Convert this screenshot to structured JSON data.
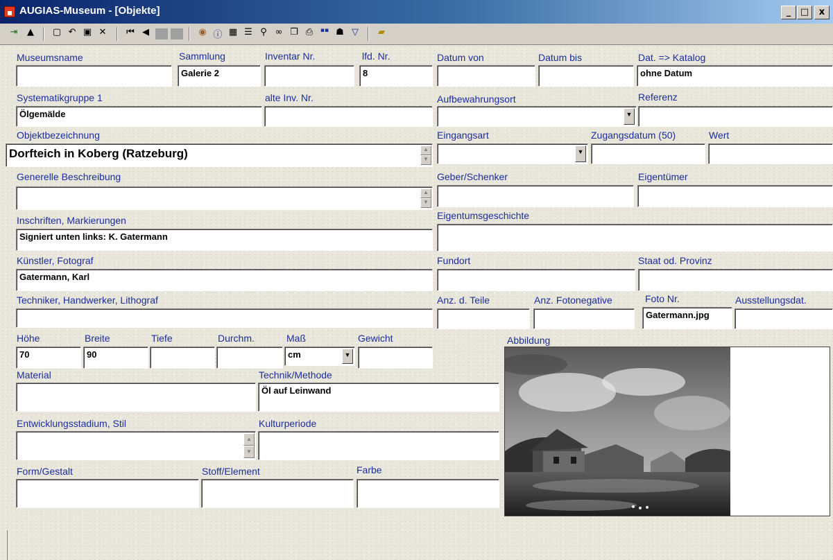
{
  "window": {
    "title": "AUGIAS-Museum - [Objekte]",
    "controls": [
      "_",
      "□",
      "x"
    ]
  },
  "toolbar": {
    "icons": [
      "new-record-icon",
      "up-arrow-icon",
      "new-document-icon",
      "undo-icon",
      "save-icon",
      "delete-icon",
      "first-record-icon",
      "previous-record-icon",
      "next-record-icon",
      "last-record-icon",
      "globe-icon",
      "info-icon",
      "image-icon",
      "list-icon",
      "search-icon",
      "binoculars-icon",
      "copy-icon",
      "print-icon",
      "text-icon",
      "person-icon",
      "filter-icon",
      "folder-icon"
    ]
  },
  "form": {
    "museumsname": {
      "label": "Museumsname",
      "value": ""
    },
    "sammlung": {
      "label": "Sammlung",
      "value": "Galerie 2"
    },
    "inventar_nr": {
      "label": "Inventar Nr.",
      "value": ""
    },
    "lfd_nr": {
      "label": "lfd. Nr.",
      "value": "8"
    },
    "datum_von": {
      "label": "Datum von",
      "value": ""
    },
    "datum_bis": {
      "label": "Datum bis",
      "value": ""
    },
    "dat_katalog": {
      "label": "Dat. => Katalog",
      "value": "ohne Datum"
    },
    "systematikgruppe": {
      "label": "Systematikgruppe 1",
      "value": "Ölgemälde"
    },
    "alte_inv_nr": {
      "label": "alte Inv. Nr.",
      "value": ""
    },
    "aufbewahrungsort": {
      "label": "Aufbewahrungsort",
      "value": ""
    },
    "referenz": {
      "label": "Referenz",
      "value": ""
    },
    "objektbezeichnung": {
      "label": "Objektbezeichnung",
      "value": "Dorfteich in Koberg (Ratzeburg)"
    },
    "eingangsart": {
      "label": "Eingangsart",
      "value": ""
    },
    "zugangsdatum": {
      "label": "Zugangsdatum (50)",
      "value": ""
    },
    "wert": {
      "label": "Wert",
      "value": ""
    },
    "generelle_beschreibung": {
      "label": "Generelle Beschreibung",
      "value": ""
    },
    "geber_schenker": {
      "label": "Geber/Schenker",
      "value": ""
    },
    "eigentuemer": {
      "label": "Eigentümer",
      "value": ""
    },
    "eigentumsgeschichte": {
      "label": "Eigentumsgeschichte",
      "value": ""
    },
    "inschriften": {
      "label": "Inschriften, Markierungen",
      "value": "Signiert unten links: K. Gatermann"
    },
    "kuenstler": {
      "label": "Künstler, Fotograf",
      "value": "Gatermann, Karl"
    },
    "fundort": {
      "label": "Fundort",
      "value": ""
    },
    "staat": {
      "label": "Staat od. Provinz",
      "value": ""
    },
    "techniker": {
      "label": "Techniker, Handwerker, Lithograf",
      "value": ""
    },
    "anz_teile": {
      "label": "Anz. d. Teile",
      "value": ""
    },
    "anz_fotonegative": {
      "label": "Anz. Fotonegative",
      "value": ""
    },
    "foto_nr": {
      "label": "Foto Nr.",
      "value": "Gatermann.jpg"
    },
    "ausstellungsdat": {
      "label": "Ausstellungsdat.",
      "value": ""
    },
    "hoehe": {
      "label": "Höhe",
      "value": "70"
    },
    "breite": {
      "label": "Breite",
      "value": "90"
    },
    "tiefe": {
      "label": "Tiefe",
      "value": ""
    },
    "durchm": {
      "label": "Durchm.",
      "value": ""
    },
    "mass": {
      "label": "Maß",
      "value": "cm"
    },
    "gewicht": {
      "label": "Gewicht",
      "value": ""
    },
    "abbildung": {
      "label": "Abbildung"
    },
    "material": {
      "label": "Material",
      "value": ""
    },
    "technik": {
      "label": "Technik/Methode",
      "value": "Öl auf Leinwand"
    },
    "entwicklungsstadium": {
      "label": "Entwicklungsstadium, Stil",
      "value": ""
    },
    "kulturperiode": {
      "label": "Kulturperiode",
      "value": ""
    },
    "form_gestalt": {
      "label": "Form/Gestalt",
      "value": ""
    },
    "stoff_element": {
      "label": "Stoff/Element",
      "value": ""
    },
    "farbe": {
      "label": "Farbe",
      "value": ""
    }
  },
  "colors": {
    "label": "#1c2e9c",
    "title_start": "#0a246a",
    "title_end": "#a6caf0",
    "face": "#d4d0c8"
  }
}
